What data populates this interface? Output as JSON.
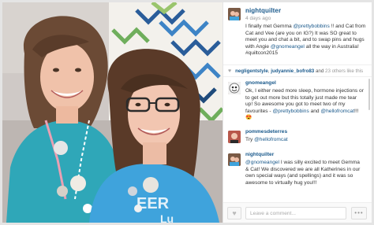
{
  "post": {
    "author": "nightquilter",
    "time": "4 days ago",
    "caption": {
      "p1": "I finally met Gemma ",
      "m1": "@prettybobbins",
      "p2": " !! and Cat from Cat and Vee (are you on IG?) It was SO great to meet you and chat a bit, and to swap pins and hugs with Angie ",
      "m2": "@gnomeangel",
      "p3": " all the way in Australia! #quiltcon2015"
    }
  },
  "likes": {
    "icon": "heart-icon",
    "user1": "negligentstyle",
    "sep": ", ",
    "user2": "judyannie_bofro83",
    "and": " and ",
    "more": "23 others like this"
  },
  "comments": [
    {
      "user": "gnomeangel",
      "p1": "Ok, I either need more sleep, hormone injections or to get out more but this totally just made me tear up! So awesome you got to meet two of my favourites - ",
      "m1": "@prettybobbins",
      "p2": " and ",
      "m2": "@hellofromcat",
      "p3": "!!! ",
      "emoji": "😍"
    },
    {
      "user": "pommesdeterres",
      "p1": "Try ",
      "m1": "@hellofromcat"
    },
    {
      "user": "nightquilter",
      "m1": "@gnomeangel",
      "p1": " I was silly excited to meet Gemma & Cat! We discovered we are all Katherines in our own special ways (and spellings) and it was so awesome to virtually hug you!!!"
    }
  ],
  "footer": {
    "like_icon": "heart-icon",
    "placeholder": "Leave a comment...",
    "more_label": "•••"
  },
  "colors": {
    "link": "#1b5a8c",
    "shirt": "#2f9ed6",
    "quilt_blue": "#2a5d9a",
    "quilt_green": "#6fae5c"
  }
}
